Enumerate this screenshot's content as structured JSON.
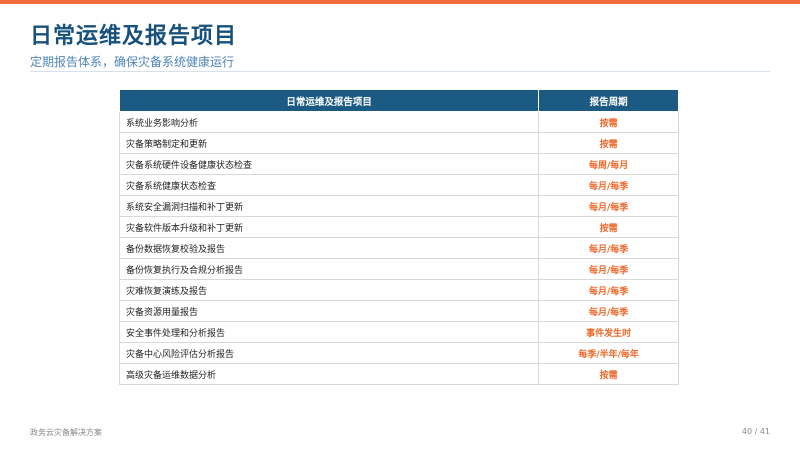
{
  "header": {
    "title": "日常运维及报告项目",
    "subtitle": "定期报告体系，确保灾备系统健康运行"
  },
  "table": {
    "columns": [
      "日常运维及报告项目",
      "报告周期"
    ],
    "rows": [
      {
        "item": "系统业务影响分析",
        "cycle": "按需"
      },
      {
        "item": "灾备策略制定和更新",
        "cycle": "按需"
      },
      {
        "item": "灾备系统硬件设备健康状态检查",
        "cycle": "每周/每月"
      },
      {
        "item": "灾备系统健康状态检查",
        "cycle": "每月/每季"
      },
      {
        "item": "系统安全漏洞扫描和补丁更新",
        "cycle": "每月/每季"
      },
      {
        "item": "灾备软件版本升级和补丁更新",
        "cycle": "按需"
      },
      {
        "item": "备份数据恢复校验及报告",
        "cycle": "每月/每季"
      },
      {
        "item": "备份恢复执行及合规分析报告",
        "cycle": "每月/每季"
      },
      {
        "item": "灾难恢复演练及报告",
        "cycle": "每月/每季"
      },
      {
        "item": "灾备资源用量报告",
        "cycle": "每月/每季"
      },
      {
        "item": "安全事件处理和分析报告",
        "cycle": "事件发生时"
      },
      {
        "item": "灾备中心风险评估分析报告",
        "cycle": "每季/半年/每年"
      },
      {
        "item": "高级灾备运维数据分析",
        "cycle": "按需"
      }
    ]
  },
  "footer": {
    "left": "政务云灾备解决方案",
    "page": "40 / 41"
  },
  "colors": {
    "accent": "#ef6c3a",
    "title": "#16507c",
    "header_bg": "#1b5a82",
    "cycle_text": "#ee6a2c"
  }
}
